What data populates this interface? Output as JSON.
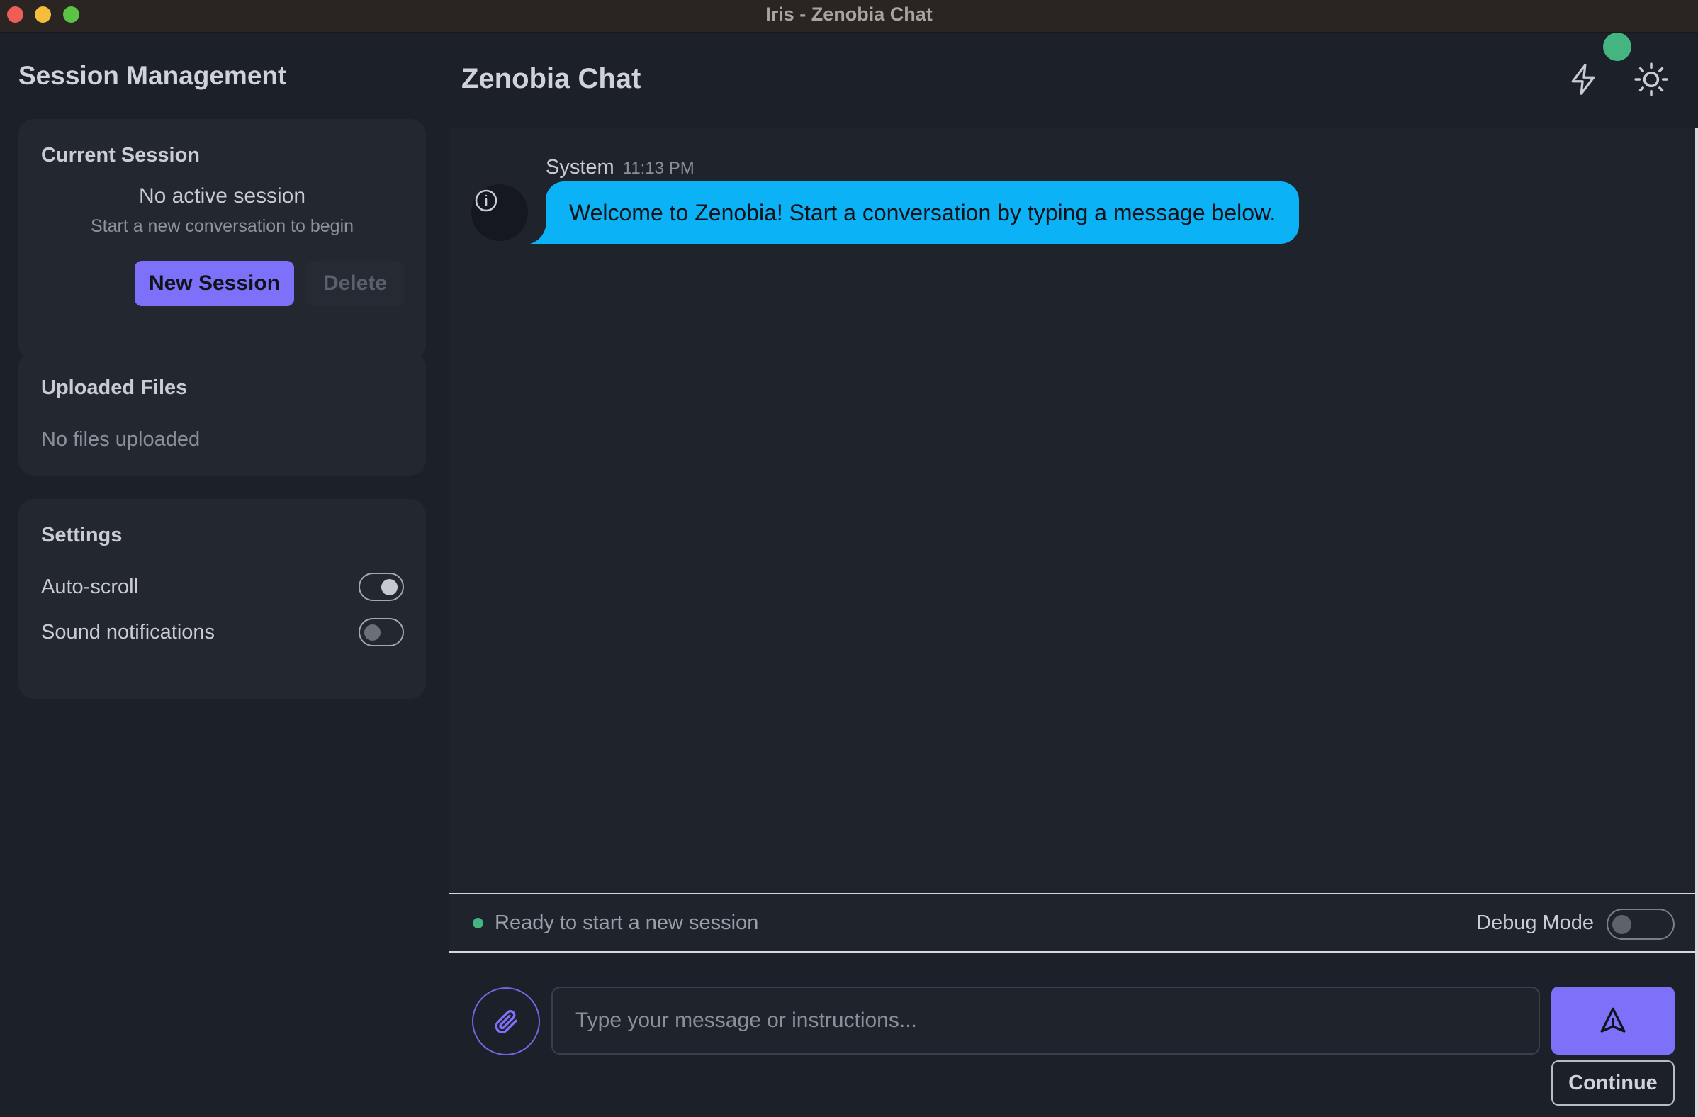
{
  "window": {
    "title": "Iris - Zenobia Chat"
  },
  "sidebar": {
    "title": "Session Management",
    "current_session": {
      "title": "Current Session",
      "status": "No active session",
      "hint": "Start a new conversation to begin",
      "new_label": "New Session",
      "delete_label": "Delete"
    },
    "uploaded_files": {
      "title": "Uploaded Files",
      "empty_text": "No files uploaded"
    },
    "settings": {
      "title": "Settings",
      "items": [
        {
          "label": "Auto-scroll",
          "enabled": true
        },
        {
          "label": "Sound notifications",
          "enabled": false
        }
      ]
    }
  },
  "header": {
    "title": "Zenobia Chat",
    "icons": [
      "lightning-icon",
      "sun-icon"
    ],
    "status_color": "#44b480"
  },
  "chat": {
    "messages": [
      {
        "sender": "System",
        "time": "11:13 PM",
        "text": "Welcome to Zenobia! Start a conversation by typing a message below.",
        "icon": "info-icon"
      }
    ]
  },
  "status_bar": {
    "text": "Ready to start a new session",
    "debug_label": "Debug Mode",
    "debug_enabled": false
  },
  "composer": {
    "placeholder": "Type your message or instructions...",
    "value": "",
    "continue_label": "Continue",
    "accent": "#7c71f8"
  }
}
